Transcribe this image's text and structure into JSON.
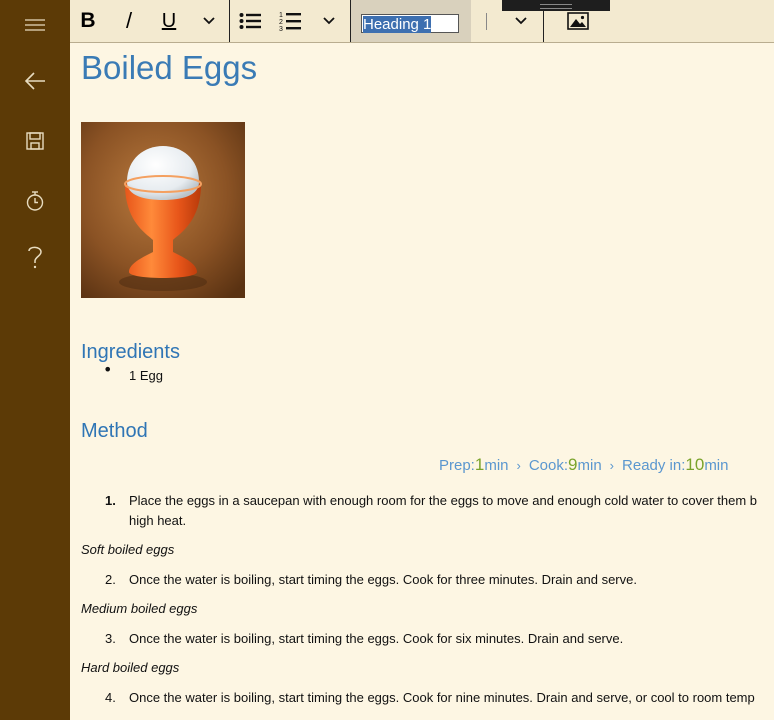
{
  "toolbar": {
    "bold_label": "B",
    "italic_label": "/",
    "underline_label": "U",
    "paragraph_style": "Heading 1"
  },
  "doc": {
    "title": "Boiled Eggs",
    "ingredients_heading": "Ingredients",
    "ingredients": [
      "1 Egg"
    ],
    "method_heading": "Method",
    "prep_label": "Prep:",
    "prep_value": "1",
    "prep_unit": "min",
    "cook_label": "Cook:",
    "cook_value": "9",
    "cook_unit": "min",
    "ready_label": "Ready in:",
    "ready_value": "10",
    "ready_unit": "min",
    "steps": [
      {
        "num": "1.",
        "line1": "Place the eggs in a saucepan with enough room for the eggs to move and enough cold water to cover them b",
        "line2": "high heat."
      },
      {
        "sub": "Soft boiled eggs",
        "num": "2.",
        "text": "Once the water is boiling, start timing the eggs. Cook for three minutes. Drain and serve."
      },
      {
        "sub": "Medium boiled eggs",
        "num": "3.",
        "text": "Once the water is boiling, start timing the eggs. Cook for six minutes. Drain and serve."
      },
      {
        "sub": "Hard boiled eggs",
        "num": "4.",
        "text": "Once the water is boiling, start timing the eggs. Cook for nine minutes. Drain and serve, or cool to room temp"
      }
    ]
  }
}
